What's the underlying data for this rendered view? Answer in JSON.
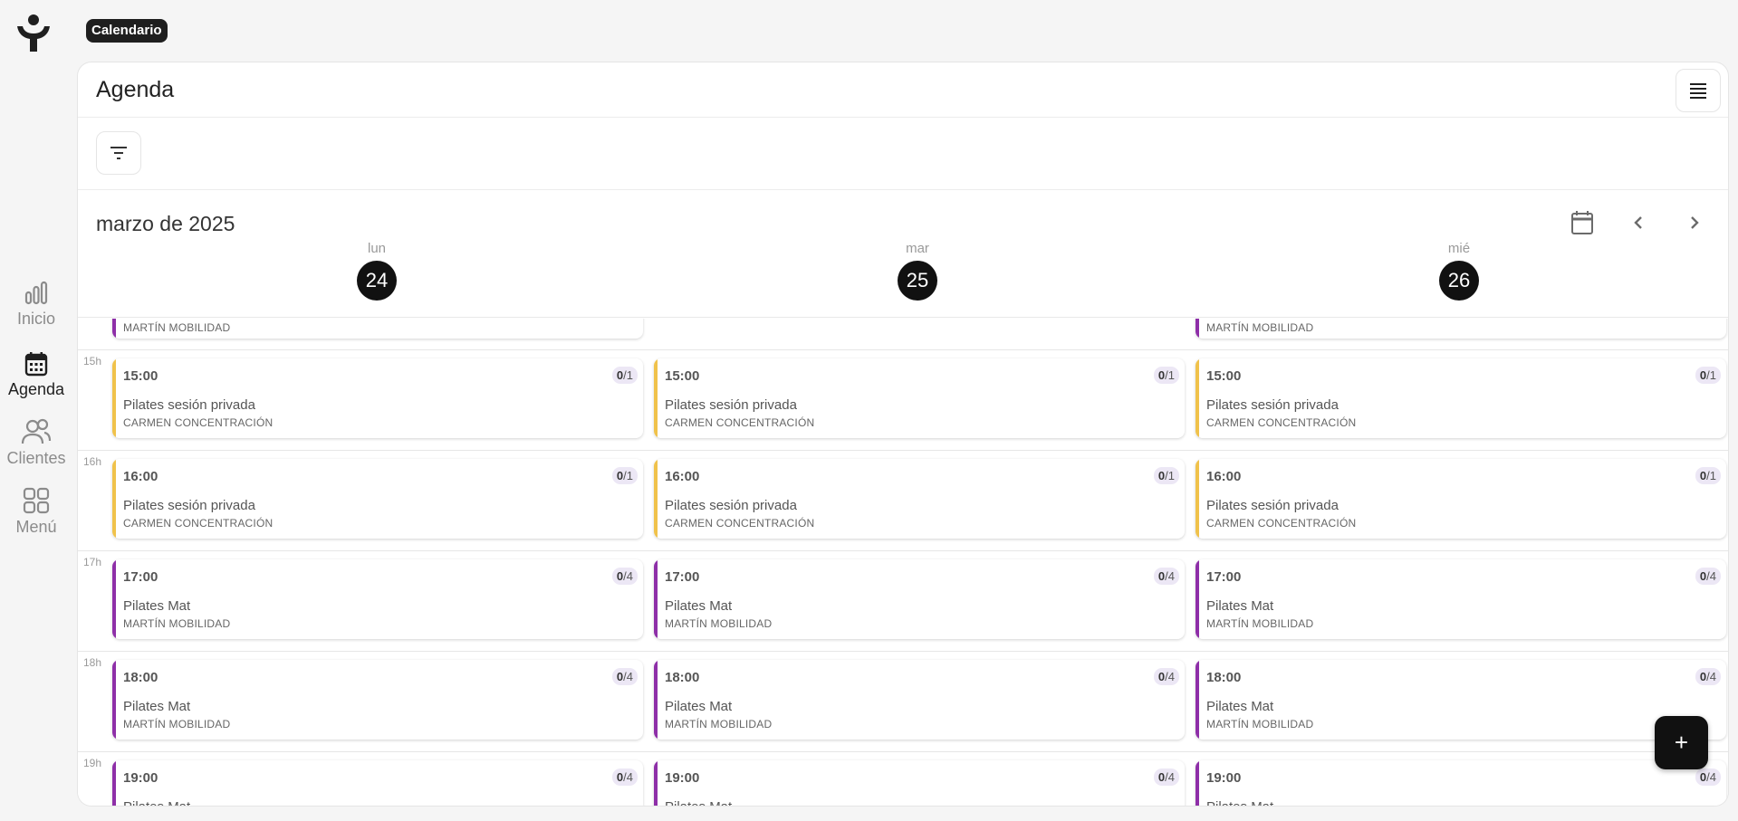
{
  "app": {
    "breadcrumb": "Calendario"
  },
  "nav": {
    "items": [
      {
        "label": "Inicio",
        "icon": "bar-chart-icon"
      },
      {
        "label": "Agenda",
        "icon": "calendar-icon",
        "active": true
      },
      {
        "label": "Clientes",
        "icon": "users-icon"
      },
      {
        "label": "Menú",
        "icon": "grid-icon"
      }
    ]
  },
  "page": {
    "title": "Agenda"
  },
  "calendar": {
    "month": "marzo de 2025",
    "days": [
      {
        "name": "lun",
        "num": "24"
      },
      {
        "name": "mar",
        "num": "25"
      },
      {
        "name": "mié",
        "num": "26"
      }
    ],
    "hours": [
      "15h",
      "16h",
      "17h",
      "18h",
      "19h"
    ],
    "partial_above": [
      {
        "trainer": "MARTÍN MOBILIDAD"
      },
      {
        "trainer": "MARTÍN MOBILIDAD"
      }
    ],
    "slots": [
      {
        "time": "15:00",
        "booked": "0",
        "capacity": "/1",
        "name": "Pilates sesión privada",
        "trainer": "CARMEN CONCENTRACIÓN",
        "color": "#f0c24b"
      },
      {
        "time": "16:00",
        "booked": "0",
        "capacity": "/1",
        "name": "Pilates sesión privada",
        "trainer": "CARMEN CONCENTRACIÓN",
        "color": "#f0c24b"
      },
      {
        "time": "17:00",
        "booked": "0",
        "capacity": "/4",
        "name": "Pilates Mat",
        "trainer": "MARTÍN MOBILIDAD",
        "color": "#8e2fa8"
      },
      {
        "time": "18:00",
        "booked": "0",
        "capacity": "/4",
        "name": "Pilates Mat",
        "trainer": "MARTÍN MOBILIDAD",
        "color": "#8e2fa8"
      },
      {
        "time": "19:00",
        "booked": "0",
        "capacity": "/4",
        "name": "Pilates Mat",
        "trainer": "",
        "color": "#8e2fa8"
      }
    ]
  },
  "fab": {
    "label": "+"
  }
}
